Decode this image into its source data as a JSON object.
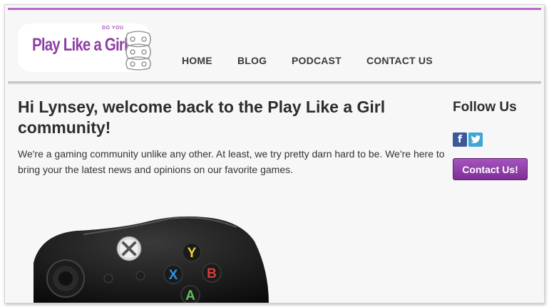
{
  "header": {
    "logo": {
      "text": "Play Like a Girl",
      "tagline": "DO YOU"
    },
    "nav": [
      {
        "label": "HOME"
      },
      {
        "label": "BLOG"
      },
      {
        "label": "PODCAST"
      },
      {
        "label": "CONTACT US"
      }
    ]
  },
  "main": {
    "headline": "Hi Lynsey, welcome back to the Play Like a Girl community!",
    "intro": "We're a gaming community unlike any other. At least, we try pretty darn hard to be. We're here to bring your the latest news and opinions on our favorite games.",
    "controller_buttons": {
      "a": "A",
      "b": "B",
      "x": "X",
      "y": "Y"
    }
  },
  "sidebar": {
    "follow_heading": "Follow Us",
    "social": {
      "facebook": "f",
      "twitter": "t"
    },
    "contact_button": "Contact Us!"
  },
  "colors": {
    "accent": "#8e3fa3",
    "topline": "#b86bc8",
    "button": "#9444ad",
    "facebook": "#3b5998",
    "twitter": "#3fa6d6"
  }
}
